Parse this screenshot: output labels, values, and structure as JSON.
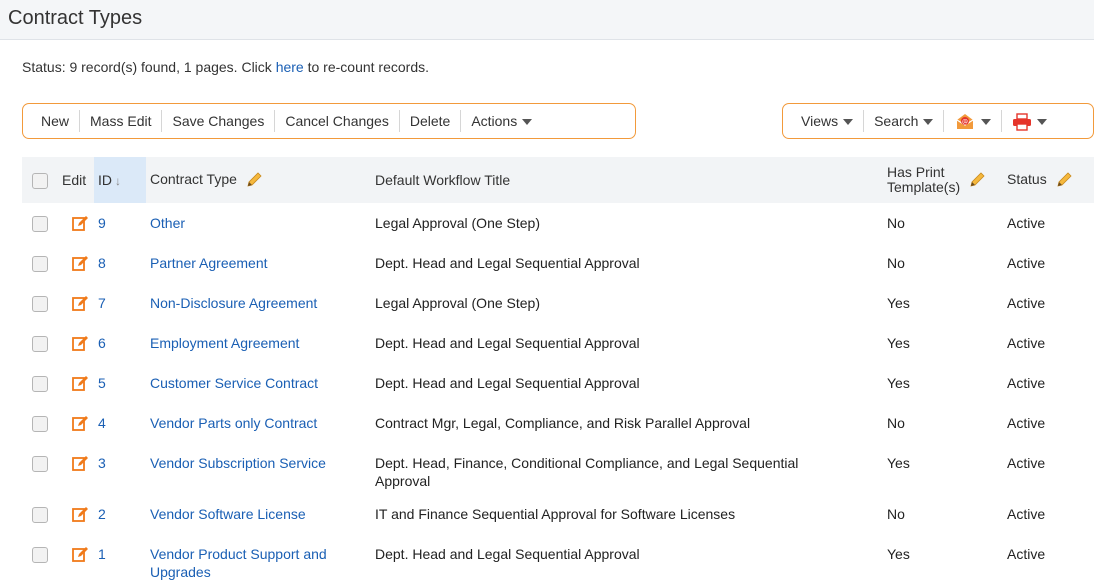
{
  "page": {
    "title": "Contract Types",
    "status_prefix": "Status: 9 record(s) found, 1 pages. Click ",
    "status_link": "here",
    "status_suffix": " to re-count records."
  },
  "toolbar_left": {
    "new": "New",
    "mass_edit": "Mass Edit",
    "save_changes": "Save Changes",
    "cancel_changes": "Cancel Changes",
    "delete": "Delete",
    "actions": "Actions"
  },
  "toolbar_right": {
    "views": "Views",
    "search": "Search"
  },
  "columns": {
    "edit": "Edit",
    "id": "ID",
    "contract_type": "Contract Type",
    "workflow": "Default Workflow Title",
    "has_print_1": "Has Print",
    "has_print_2": "Template(s)",
    "status": "Status"
  },
  "rows": [
    {
      "id": "9",
      "type": "Other",
      "type2": "",
      "workflow": "Legal Approval (One Step)",
      "workflow2": "",
      "print": "No",
      "status": "Active"
    },
    {
      "id": "8",
      "type": "Partner Agreement",
      "type2": "",
      "workflow": "Dept. Head and Legal Sequential Approval",
      "workflow2": "",
      "print": "No",
      "status": "Active"
    },
    {
      "id": "7",
      "type": "Non-Disclosure Agreement",
      "type2": "",
      "workflow": "Legal Approval (One Step)",
      "workflow2": "",
      "print": "Yes",
      "status": "Active"
    },
    {
      "id": "6",
      "type": "Employment Agreement",
      "type2": "",
      "workflow": "Dept. Head and Legal Sequential Approval",
      "workflow2": "",
      "print": "Yes",
      "status": "Active"
    },
    {
      "id": "5",
      "type": "Customer Service Contract",
      "type2": "",
      "workflow": "Dept. Head and Legal Sequential Approval",
      "workflow2": "",
      "print": "Yes",
      "status": "Active"
    },
    {
      "id": "4",
      "type": "Vendor Parts only Contract",
      "type2": "",
      "workflow": "Contract Mgr, Legal, Compliance, and Risk Parallel Approval",
      "workflow2": "",
      "print": "No",
      "status": "Active"
    },
    {
      "id": "3",
      "type": "Vendor Subscription Service",
      "type2": "",
      "workflow": "Dept. Head, Finance, Conditional Compliance, and Legal Sequential",
      "workflow2": "Approval",
      "print": "Yes",
      "status": "Active"
    },
    {
      "id": "2",
      "type": "Vendor Software License",
      "type2": "",
      "workflow": "IT and Finance Sequential Approval for Software Licenses",
      "workflow2": "",
      "print": "No",
      "status": "Active"
    },
    {
      "id": "1",
      "type": "Vendor Product Support and",
      "type2": "Upgrades",
      "workflow": "Dept. Head and Legal Sequential Approval",
      "workflow2": "",
      "print": "Yes",
      "status": "Active"
    }
  ],
  "colors": {
    "accent_orange": "#f29a3b",
    "link_blue": "#1a5fb4",
    "edit_icon_orange": "#f07a1a",
    "pencil_yellow": "#f5b83d"
  }
}
